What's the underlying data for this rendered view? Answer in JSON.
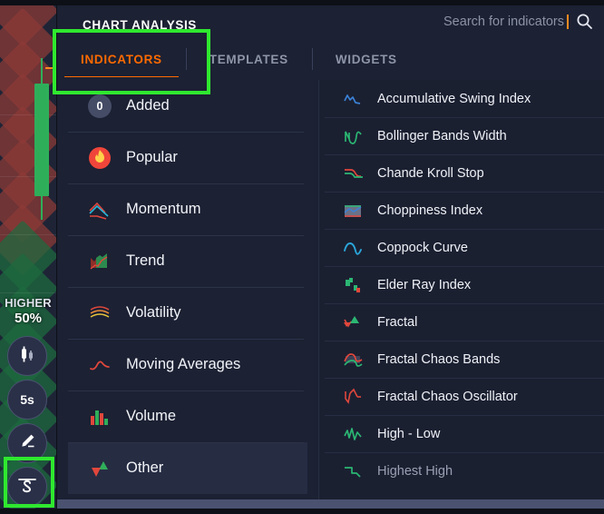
{
  "panel": {
    "title": "CHART ANALYSIS"
  },
  "search": {
    "placeholder": "Search for indicators",
    "value": "",
    "icon": "search-icon"
  },
  "tabs": [
    {
      "label": "INDICATORS",
      "active": true
    },
    {
      "label": "TEMPLATES",
      "active": false
    },
    {
      "label": "WIDGETS",
      "active": false
    }
  ],
  "categories": [
    {
      "label": "Added",
      "icon": "count-badge-icon",
      "badge": "0",
      "selected": false
    },
    {
      "label": "Popular",
      "icon": "flame-icon",
      "selected": false
    },
    {
      "label": "Momentum",
      "icon": "momentum-lines-icon",
      "selected": false
    },
    {
      "label": "Trend",
      "icon": "trend-area-icon",
      "selected": false
    },
    {
      "label": "Volatility",
      "icon": "volatility-waves-icon",
      "selected": false
    },
    {
      "label": "Moving Averages",
      "icon": "moving-average-curve-icon",
      "selected": false
    },
    {
      "label": "Volume",
      "icon": "volume-bars-icon",
      "selected": false
    },
    {
      "label": "Other",
      "icon": "up-down-arrows-icon",
      "selected": true
    }
  ],
  "indicators": [
    {
      "label": "Accumulative Swing Index",
      "icon": "swing-index-icon",
      "dim": false
    },
    {
      "label": "Bollinger Bands Width",
      "icon": "bollinger-width-icon",
      "dim": false
    },
    {
      "label": "Chande Kroll Stop",
      "icon": "chande-kroll-icon",
      "dim": false
    },
    {
      "label": "Choppiness Index",
      "icon": "choppiness-icon",
      "dim": false
    },
    {
      "label": "Coppock Curve",
      "icon": "coppock-curve-icon",
      "dim": false
    },
    {
      "label": "Elder Ray Index",
      "icon": "elder-ray-icon",
      "dim": false
    },
    {
      "label": "Fractal",
      "icon": "fractal-icon",
      "dim": false
    },
    {
      "label": "Fractal Chaos Bands",
      "icon": "fractal-chaos-bands-icon",
      "dim": false
    },
    {
      "label": "Fractal Chaos Oscillator",
      "icon": "fractal-chaos-osc-icon",
      "dim": false
    },
    {
      "label": "High - Low",
      "icon": "high-low-icon",
      "dim": false
    },
    {
      "label": "Highest High",
      "icon": "highest-high-icon",
      "dim": true
    }
  ],
  "chart": {
    "sentiment_label": "HIGHER",
    "sentiment_percent": "50%"
  },
  "toolbar": [
    {
      "name": "chart-type-button",
      "label": "",
      "icon": "candlestick-icon"
    },
    {
      "name": "timeframe-button",
      "label": "5s",
      "icon": "text-label"
    },
    {
      "name": "draw-button",
      "label": "",
      "icon": "pencil-icon"
    },
    {
      "name": "indicators-button",
      "label": "",
      "icon": "squiggle-icon",
      "highlighted": true
    }
  ],
  "colors": {
    "accent_orange": "#ff6a00",
    "highlight_green": "#2fe82f",
    "panel_bg": "#1c2133",
    "bullish_green": "#2fae5a",
    "bearish_red": "#8e3a36"
  }
}
